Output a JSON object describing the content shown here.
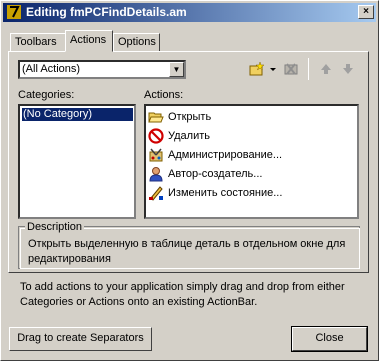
{
  "window": {
    "title": "Editing fmPCFindDetails.am",
    "close_glyph": "×"
  },
  "tabs": [
    {
      "label": "Toolbars"
    },
    {
      "label": "Actions"
    },
    {
      "label": "Options"
    }
  ],
  "actions_tab": {
    "filter": {
      "selected": "(All Actions)"
    },
    "categories_label": "Categories:",
    "actions_label": "Actions:",
    "categories": [
      "(No Category)"
    ],
    "actions": [
      {
        "label": "Открыть",
        "icon": "open-folder-icon"
      },
      {
        "label": "Удалить",
        "icon": "no-entry-icon"
      },
      {
        "label": "Администрирование...",
        "icon": "admin-tools-icon"
      },
      {
        "label": "Автор-создатель...",
        "icon": "user-icon"
      },
      {
        "label": "Изменить состояние...",
        "icon": "state-pencil-icon"
      }
    ],
    "description_title": "Description",
    "description": "Открыть выделенную в таблице деталь в отдельном окне для редактирования",
    "hint": "To add actions to your application simply drag and drop from either Categories or Actions onto an existing ActionBar."
  },
  "buttons": {
    "separators": "Drag to create Separators",
    "close": "Close"
  },
  "colors": {
    "title_start": "#0a246a",
    "title_end": "#a6caf0",
    "face": "#d4d0c8",
    "selection": "#0a246a"
  }
}
